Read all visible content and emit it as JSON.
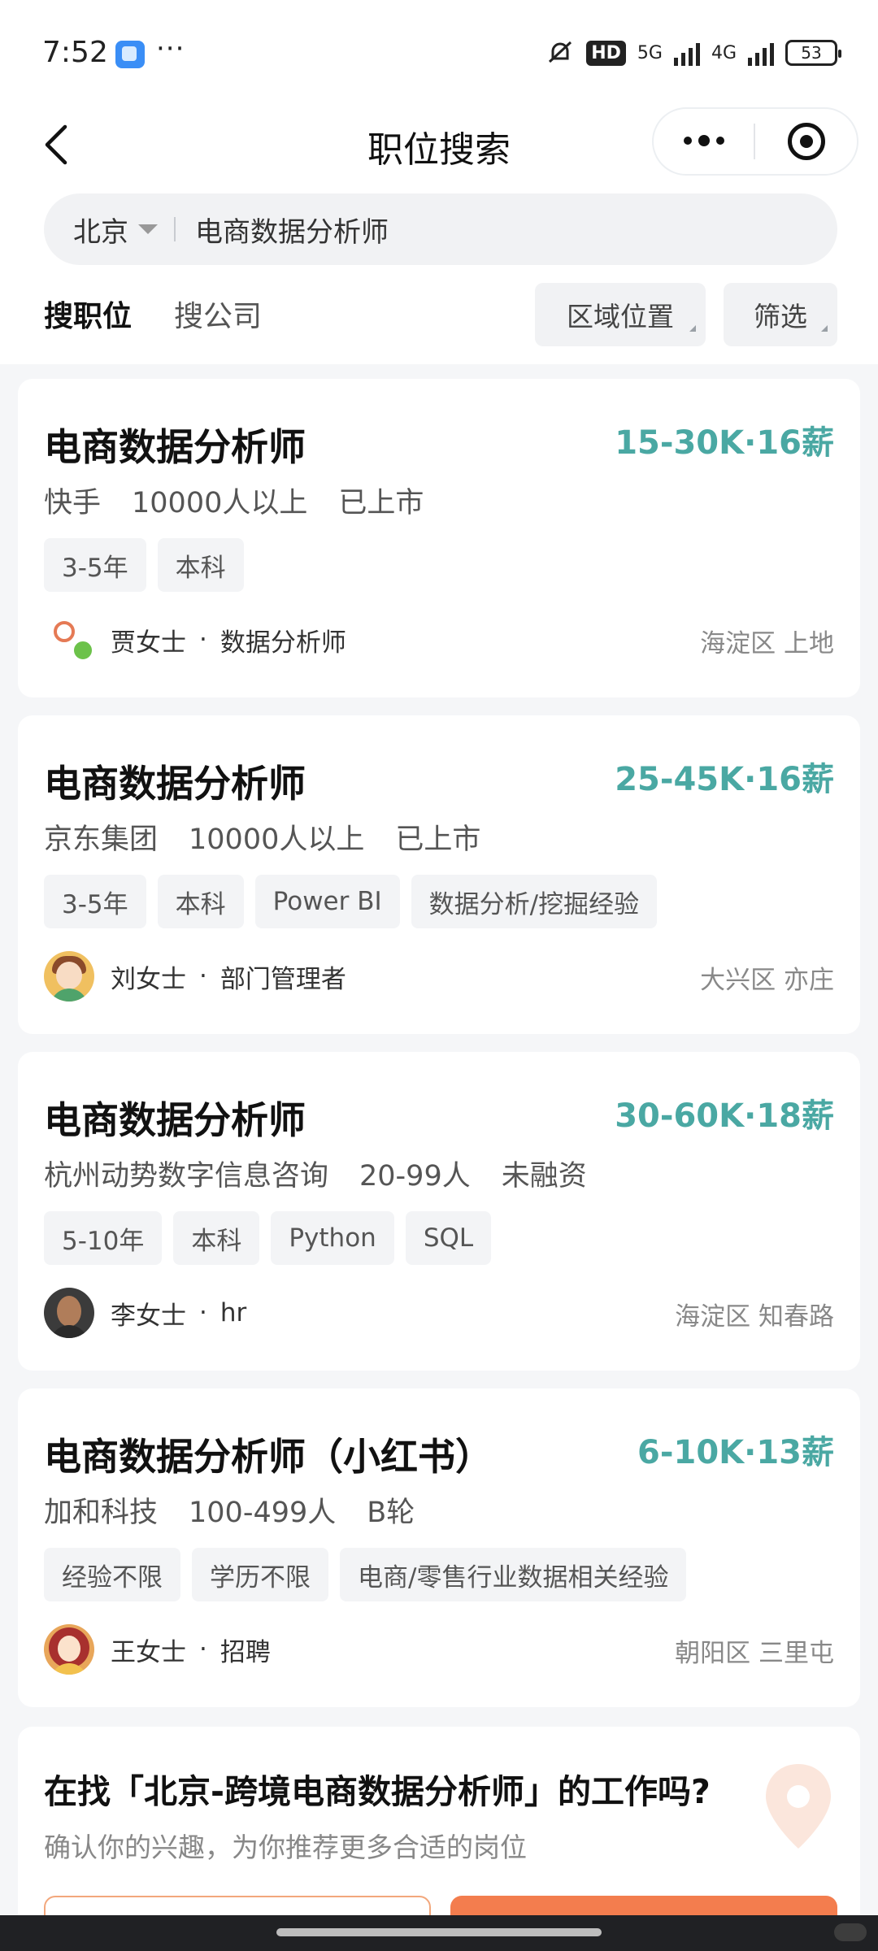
{
  "status_bar": {
    "time": "7:52",
    "more": "···",
    "hd": "HD",
    "net1": "5G",
    "net2": "4G",
    "battery": "53"
  },
  "nav": {
    "title": "职位搜索"
  },
  "search": {
    "city": "北京",
    "query": "电商数据分析师"
  },
  "tabs": {
    "active": "搜职位",
    "inactive": "搜公司"
  },
  "filters": {
    "region": "区域位置",
    "screen": "筛选"
  },
  "jobs": [
    {
      "title": "电商数据分析师",
      "salary": "15-30K·16薪",
      "company": "快手",
      "size": "10000人以上",
      "stage": "已上市",
      "tags": [
        "3-5年",
        "本科"
      ],
      "recruiter": "贾女士",
      "role": "数据分析师",
      "location": "海淀区 上地"
    },
    {
      "title": "电商数据分析师",
      "salary": "25-45K·16薪",
      "company": "京东集团",
      "size": "10000人以上",
      "stage": "已上市",
      "tags": [
        "3-5年",
        "本科",
        "Power BI",
        "数据分析/挖掘经验"
      ],
      "recruiter": "刘女士",
      "role": "部门管理者",
      "location": "大兴区 亦庄"
    },
    {
      "title": "电商数据分析师",
      "salary": "30-60K·18薪",
      "company": "杭州动势数字信息咨询",
      "size": "20-99人",
      "stage": "未融资",
      "tags": [
        "5-10年",
        "本科",
        "Python",
        "SQL"
      ],
      "recruiter": "李女士",
      "role": "hr",
      "location": "海淀区 知春路"
    },
    {
      "title": "电商数据分析师（小红书）",
      "salary": "6-10K·13薪",
      "company": "加和科技",
      "size": "100-499人",
      "stage": "B轮",
      "tags": [
        "经验不限",
        "学历不限",
        "电商/零售行业数据相关经验"
      ],
      "recruiter": "王女士",
      "role": "招聘",
      "location": "朝阳区 三里屯"
    }
  ],
  "promo": {
    "title": "在找「北京-跨境电商数据分析师」的工作吗?",
    "subtitle": "确认你的兴趣，为你推荐更多合适的岗位"
  },
  "colors": {
    "salary": "#4aa8a3",
    "accent": "#f37d4e",
    "page_bg": "#f5f6f8"
  },
  "icons": [
    "back-chevron-icon",
    "more-dots-icon",
    "target-icon",
    "dropdown-caret-icon",
    "location-pin-icon"
  ]
}
